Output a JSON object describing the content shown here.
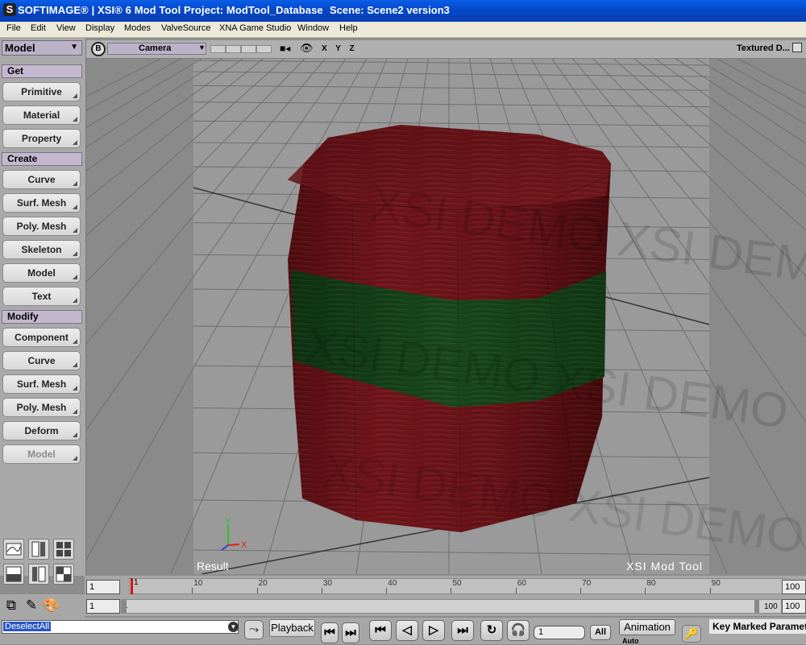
{
  "window": {
    "logo": "S",
    "title": "SOFTIMAGE® | XSI® 6 Mod Tool Project: ModTool_Database",
    "scene": "Scene: Scene2 version3"
  },
  "menu": [
    "File",
    "Edit",
    "View",
    "Display",
    "Modes",
    "ValveSource",
    "XNA Game Studio",
    "Window",
    "Help"
  ],
  "left_panel": {
    "module": "Model",
    "sections": {
      "get": "Get",
      "create": "Create",
      "modify": "Modify"
    },
    "get_buttons": [
      "Primitive",
      "Material",
      "Property"
    ],
    "create_buttons": [
      "Curve",
      "Surf. Mesh",
      "Poly. Mesh",
      "Skeleton",
      "Model",
      "Text"
    ],
    "modify_buttons": [
      "Component",
      "Curve",
      "Surf. Mesh",
      "Poly. Mesh",
      "Deform",
      "Model"
    ],
    "disabled_button": "Model"
  },
  "viewport": {
    "view_letter": "B",
    "camera": "Camera",
    "axes": "X Y Z",
    "display_mode": "Textured D...",
    "result_label": "Result",
    "brand_label": "XSI  Mod  Tool",
    "watermark": "XSI DEMO XSI DEMO",
    "axis_gizmo": {
      "x": "X",
      "y": "Y"
    },
    "colors": {
      "wood_red": "#6e1318",
      "band_green": "#163f17",
      "grid_bg": "#9a9a9a"
    }
  },
  "timeline": {
    "start_frame": "1",
    "end_frame": "100",
    "range_start": "1",
    "range_end": "100",
    "ticks": [
      "10",
      "20",
      "30",
      "40",
      "50",
      "60",
      "70",
      "80",
      "90"
    ],
    "current_frame_marker": "1"
  },
  "status": {
    "command": "DeselectAll",
    "playback_label": "Playback",
    "current_frame": "1",
    "all_label": "All",
    "animation_label": "Animation",
    "auto_label": "Auto",
    "key_label": "Key Marked Paramet"
  }
}
